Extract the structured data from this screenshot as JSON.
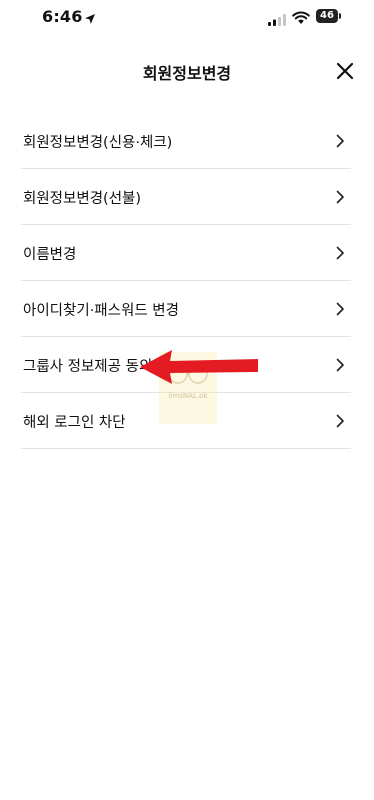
{
  "status_bar": {
    "time": "6:46",
    "battery": "46"
  },
  "header": {
    "title": "회원정보변경"
  },
  "menu": [
    {
      "label": "회원정보변경(신용·체크)"
    },
    {
      "label": "회원정보변경(선불)"
    },
    {
      "label": "이름변경"
    },
    {
      "label": "아이디찾기·패스워드 변경"
    },
    {
      "label": "그룹사 정보제공 동의"
    },
    {
      "label": "해외 로그인 차단"
    }
  ],
  "annotation": {
    "arrow_color": "#e51b23"
  },
  "watermark": {
    "text": "limsNAL.ok"
  },
  "colors": {
    "background": "#ffffff",
    "text": "#111111",
    "divider": "#e3e3e3"
  }
}
